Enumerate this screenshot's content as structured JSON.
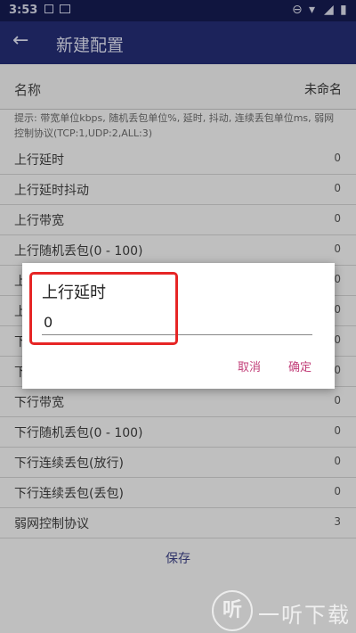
{
  "status": {
    "time": "3:53"
  },
  "appbar": {
    "back_icon": "arrow-left-icon",
    "title": "新建配置"
  },
  "name_row": {
    "label": "名称",
    "value": "未命名"
  },
  "hint": "提示: 带宽单位kbps, 随机丢包单位%, 延时, 抖动, 连续丢包单位ms, 弱网控制协议(TCP:1,UDP:2,ALL:3)",
  "settings": [
    {
      "label": "上行延时",
      "value": "0"
    },
    {
      "label": "上行延时抖动",
      "value": "0"
    },
    {
      "label": "上行带宽",
      "value": "0"
    },
    {
      "label": "上行随机丢包(0 - 100)",
      "value": "0"
    },
    {
      "label": "上",
      "value": "0"
    },
    {
      "label": "上",
      "value": "0"
    },
    {
      "label": "下",
      "value": "0"
    },
    {
      "label": "下",
      "value": "0"
    },
    {
      "label": "下行带宽",
      "value": "0"
    },
    {
      "label": "下行随机丢包(0 - 100)",
      "value": "0"
    },
    {
      "label": "下行连续丢包(放行)",
      "value": "0"
    },
    {
      "label": "下行连续丢包(丢包)",
      "value": "0"
    },
    {
      "label": "弱网控制协议",
      "value": "3"
    }
  ],
  "save_label": "保存",
  "dialog": {
    "title": "上行延时",
    "input_value": "0",
    "cancel": "取消",
    "confirm": "确定"
  },
  "watermark": {
    "logo": "听",
    "text": "一听下载"
  },
  "colors": {
    "appbar": "#232b70",
    "accent": "#c2407a",
    "highlight": "#e62525"
  }
}
